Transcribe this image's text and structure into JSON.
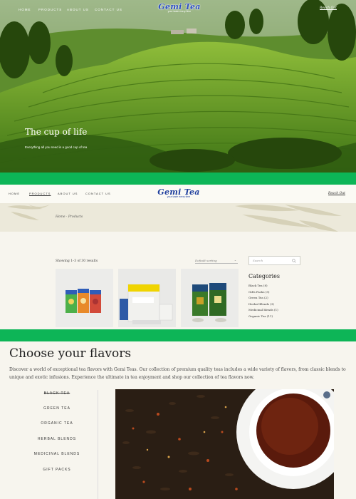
{
  "hero": {
    "nav": [
      "Home",
      "Products",
      "About Us",
      "Contact Us"
    ],
    "logo": "Gemi Tea",
    "tagline": "your taste every time",
    "reach": "Reach Out",
    "title": "The cup of life",
    "subtitle": "Everything all you need is a good cup of tea"
  },
  "shop_nav": {
    "items": [
      "Home",
      "Products",
      "About Us",
      "Contact Us"
    ],
    "active": "Products",
    "logo": "Gemi Tea",
    "tagline": "your taste every time",
    "reach": "Reach Out"
  },
  "breadcrumb": "Home · Products",
  "shop": {
    "results": "Showing 1–3 of 30 results",
    "sort": "Default sorting",
    "search_placeholder": "Search",
    "categories_title": "Categories",
    "categories": [
      "Black Tea (8)",
      "Gifts Packs (5)",
      "Green Tea (2)",
      "Herbal Blends (3)",
      "Medicinal blends (1)",
      "Organic Tea (11)"
    ]
  },
  "flavors": {
    "title": "Choose your flavors",
    "description": "Discover a world of exceptional tea flavors with Gemi Teas. Our collection of premium quality teas includes a wide variety of flavors, from classic blends to unique and exotic infusions. Experience the ultimate in tea enjoyment and shop our collection of tea flavors now.",
    "items": [
      "Black Tea",
      "Green Tea",
      "Organic Tea",
      "Herbal Blends",
      "Medicinal Blends",
      "Gift Packs"
    ],
    "active": "Black Tea"
  },
  "colors": {
    "accent_green": "#0db557",
    "logo_blue": "#1f3f9e",
    "background": "#f7f5ee"
  }
}
